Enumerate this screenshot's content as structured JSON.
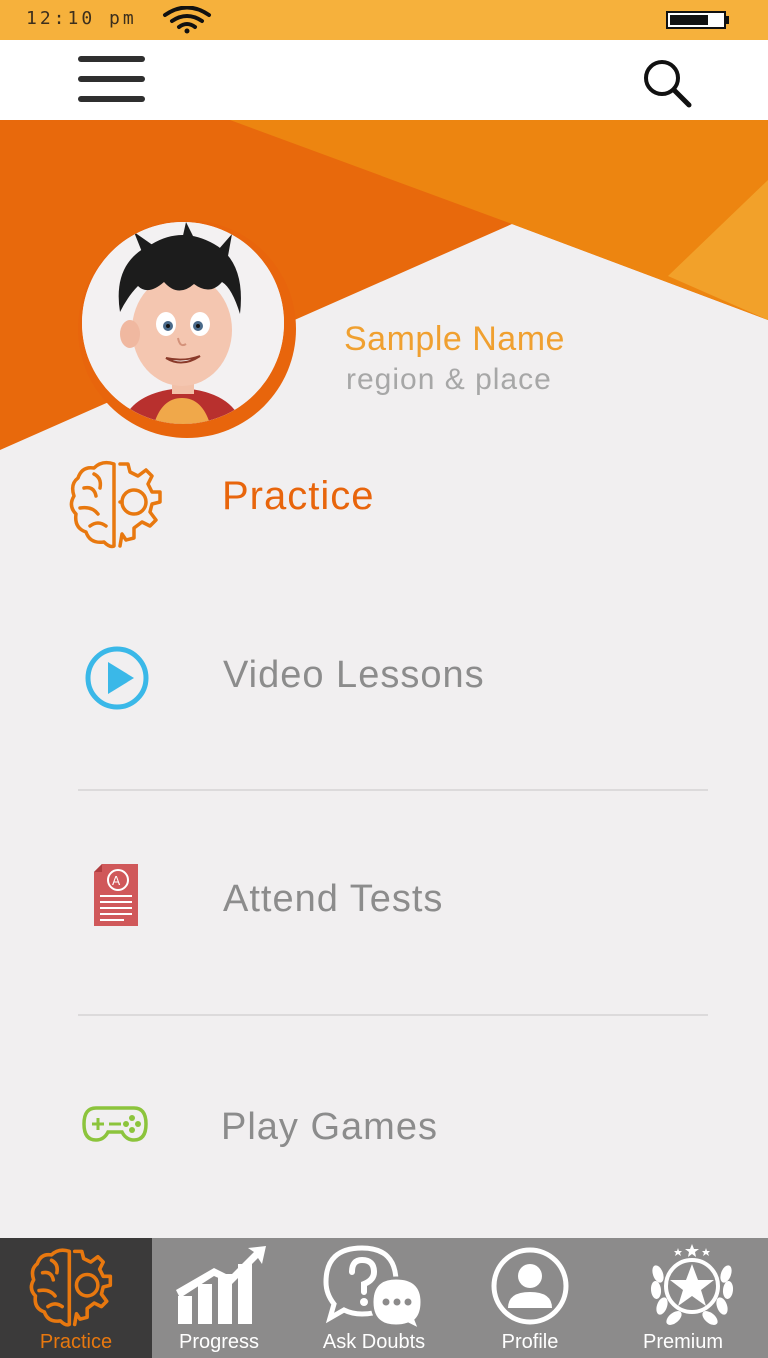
{
  "status_bar": {
    "time": "12:10 pm"
  },
  "profile": {
    "name": "Sample Name",
    "place": "region & place"
  },
  "menu": [
    {
      "label": "Practice",
      "icon": "brain-gear-icon",
      "active": true
    },
    {
      "label": "Video Lessons",
      "icon": "play-circle-icon"
    },
    {
      "label": "Attend Tests",
      "icon": "test-paper-icon"
    },
    {
      "label": "Play Games",
      "icon": "gamepad-icon"
    }
  ],
  "bottom_nav": [
    {
      "label": "Practice",
      "icon": "brain-gear-icon",
      "active": true
    },
    {
      "label": "Progress",
      "icon": "bar-chart-arrow-icon"
    },
    {
      "label": "Ask Doubts",
      "icon": "question-chat-icon"
    },
    {
      "label": "Profile",
      "icon": "user-circle-icon"
    },
    {
      "label": "Premium",
      "icon": "laurel-star-icon"
    }
  ],
  "colors": {
    "status_bar": "#f6b13c",
    "accent_orange": "#e8650c",
    "name_orange": "#f0a030",
    "nav_bg": "#8c8b8b",
    "nav_active_bg": "#3b3a3a",
    "video_blue": "#3ab8e8",
    "test_red": "#d0585a",
    "game_green": "#8cc43c"
  }
}
